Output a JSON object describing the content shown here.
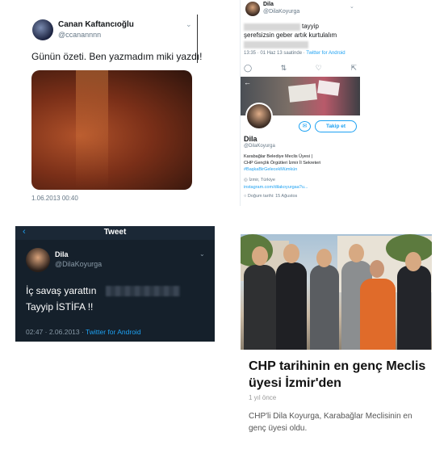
{
  "panel1": {
    "name": "Canan Kaftancıoğlu",
    "handle": "@ccanannnn",
    "chevron": "⌄",
    "text": "Günün özeti. Ben yazmadım miki yazdı!",
    "time": "1.06.2013 00:40"
  },
  "panel2": {
    "name": "Dila",
    "handle": "@DilaKoyurga",
    "chevron": "⌄",
    "tweet_line1": "tayyip",
    "tweet_line2": "şerefsizsin geber artık kurtulalım",
    "meta_time": "13:35 · 01 Haz 13 saatinde · ",
    "meta_source": "Twitter for Android",
    "action_icons": [
      "reply-icon",
      "retweet-icon",
      "like-icon",
      "share-icon"
    ],
    "follow_label": "Takip et",
    "profile_name": "Dila",
    "profile_handle": "@DilaKoyurga",
    "bio_line1": "Karabağlar Belediye Meclis Üyesi |",
    "bio_line2": "CHP Gençlik Örgütleri İzmir İl Sekreteri",
    "bio_hashtag": "#BaşkaBirGelecekMümkün",
    "location": "İzmir, Türkiye",
    "url": "instagram.com/dilakoyurgaa?u...",
    "born": "Doğum tarihi: 15 Ağustos"
  },
  "panel3": {
    "header": "Tweet",
    "name": "Dila",
    "handle": "@DilaKoyurga",
    "chevron": "⌄",
    "line1": "İç savaş yarattın",
    "line2": "Tayyip İSTİFA !!",
    "meta_time": "02:47 · 2.06.2013 · ",
    "meta_source": "Twitter for Android"
  },
  "panel4": {
    "headline": "CHP tarihinin en genç Meclis üyesi İzmir'den",
    "age": "1 yıl önce",
    "description": "CHP'li Dila Koyurga, Karabağlar Meclisinin en genç üyesi oldu."
  },
  "colors": {
    "twitter_blue": "#1da1f2",
    "dark_bg": "#15202b",
    "muted": "#657786"
  }
}
